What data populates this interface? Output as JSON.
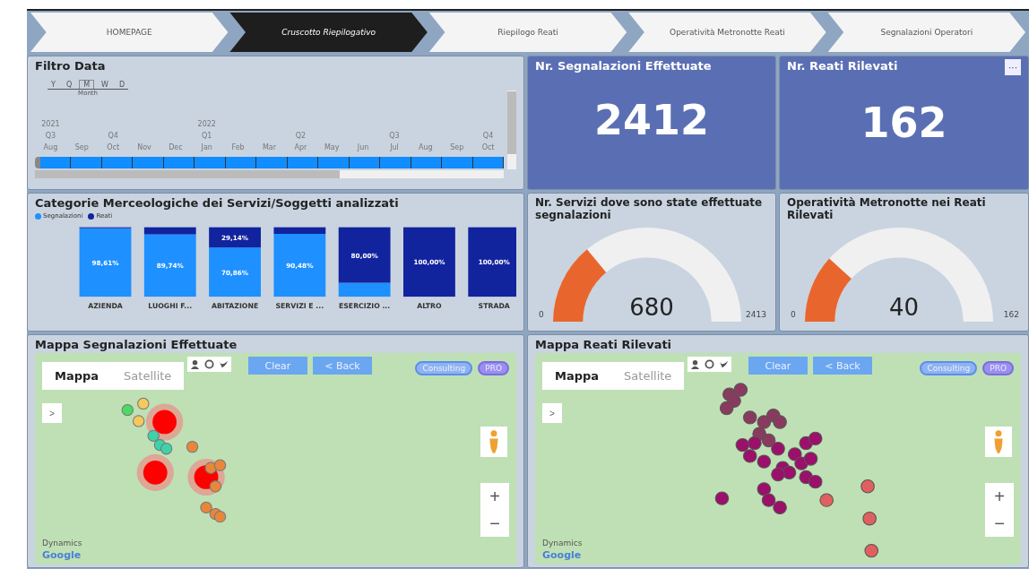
{
  "tabs": [
    {
      "label": "HOMEPAGE",
      "selected": false
    },
    {
      "label": "Cruscotto Riepilogativo",
      "selected": true
    },
    {
      "label": "Riepilogo Reati",
      "selected": false
    },
    {
      "label": "Operatività Metronotte Reati",
      "selected": false
    },
    {
      "label": "Segnalazioni Operatori",
      "selected": false
    }
  ],
  "date_filter": {
    "title": "Filtro Data",
    "levels": [
      {
        "label": "Y",
        "selected": false
      },
      {
        "label": "Q",
        "selected": false
      },
      {
        "label": "M",
        "selected": true
      },
      {
        "label": "W",
        "selected": false
      },
      {
        "label": "D",
        "selected": false
      }
    ],
    "level_caption": "Month",
    "months": [
      {
        "label": "Aug",
        "selected": true,
        "year": "2021",
        "quarter": "Q3"
      },
      {
        "label": "Sep",
        "selected": true
      },
      {
        "label": "Oct",
        "selected": true,
        "quarter": "Q4"
      },
      {
        "label": "Nov",
        "selected": true
      },
      {
        "label": "Dec",
        "selected": true
      },
      {
        "label": "Jan",
        "selected": true,
        "year": "2022",
        "quarter": "Q1"
      },
      {
        "label": "Feb",
        "selected": true
      },
      {
        "label": "Mar",
        "selected": true
      },
      {
        "label": "Apr",
        "selected": true,
        "quarter": "Q2"
      },
      {
        "label": "May",
        "selected": true
      },
      {
        "label": "Jun",
        "selected": true
      },
      {
        "label": "Jul",
        "selected": true,
        "quarter": "Q3"
      },
      {
        "label": "Aug",
        "selected": true
      },
      {
        "label": "Sep",
        "selected": true
      },
      {
        "label": "Oct",
        "selected": true,
        "quarter": "Q4"
      }
    ]
  },
  "kpis": [
    {
      "title": "Nr. Segnalazioni Effettuate",
      "value": "2412"
    },
    {
      "title": "Nr. Reati Rilevati",
      "value": "162",
      "menu": "···"
    }
  ],
  "categories_chart": {
    "title": "Categorie Merceologiche dei Servizi/Soggetti analizzati",
    "chart_data": {
      "type": "bar",
      "stacked": true,
      "orientation": "vertical",
      "categories": [
        "AZIENDA",
        "LUOGHI F...",
        "ABITAZIONE",
        "SERVIZI E ...",
        "ESERCIZIO ...",
        "ALTRO",
        "STRADA"
      ],
      "series": [
        {
          "name": "Segnalazioni",
          "color": "#1e90ff",
          "values": [
            98.61,
            89.74,
            70.86,
            90.48,
            20,
            0,
            0
          ],
          "value_labels": [
            "98,61%",
            "89,74%",
            "70,86%",
            "90,48%",
            null,
            null,
            null
          ]
        },
        {
          "name": "Reati",
          "color": "#12239e",
          "values": [
            1.39,
            10.26,
            29.14,
            9.52,
            80,
            100,
            100
          ],
          "value_labels": [
            null,
            null,
            "29,14%",
            null,
            "80,00%",
            "100,00%",
            "100,00%"
          ]
        }
      ]
    }
  },
  "gauges": [
    {
      "title": "Nr. Servizi dove sono state effettuate segnalazioni",
      "value": "680",
      "min": "0",
      "max": "2413",
      "level": 0.282
    },
    {
      "title": "Operatività Metronotte nei Reati Rilevati",
      "value": "40",
      "min": "0",
      "max": "162",
      "level": 0.247
    }
  ],
  "maps": [
    {
      "title": "Mappa Segnalazioni Effettuate",
      "kind": "heat",
      "view_tabs": [
        {
          "label": "Mappa",
          "selected": true
        },
        {
          "label": "Satellite",
          "selected": false
        }
      ],
      "buttons": [
        "Clear",
        "< Back"
      ],
      "pills": [
        "Consulting",
        "PRO"
      ],
      "expand": ">",
      "zoom_in": "+",
      "zoom_out": "−",
      "logos": [
        "Dynamics",
        "Google"
      ]
    },
    {
      "title": "Mappa Reati Rilevati",
      "kind": "points",
      "view_tabs": [
        {
          "label": "Mappa",
          "selected": true
        },
        {
          "label": "Satellite",
          "selected": false
        }
      ],
      "buttons": [
        "Clear",
        "< Back"
      ],
      "pills": [
        "Consulting",
        "PRO"
      ],
      "expand": ">",
      "zoom_in": "+",
      "zoom_out": "−",
      "logos": [
        "Dynamics",
        "Google"
      ]
    }
  ]
}
